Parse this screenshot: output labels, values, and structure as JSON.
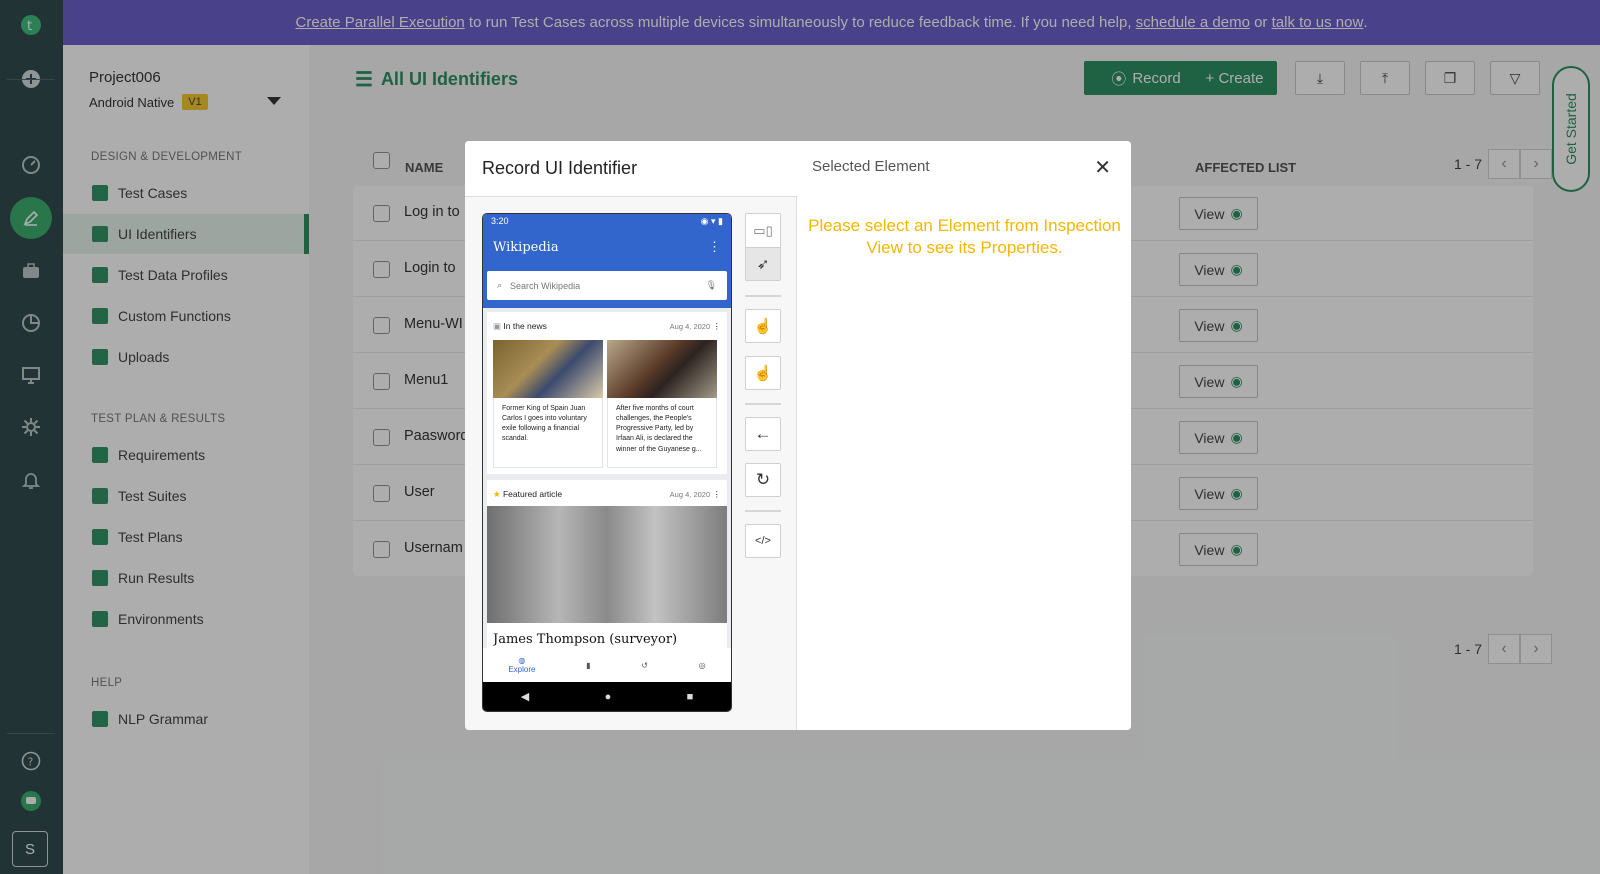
{
  "banner": {
    "link1": "Create Parallel Execution",
    "text1": " to run Test Cases across multiple devices simultaneously to reduce feedback time. If you need help, ",
    "link2": "schedule a demo",
    "text2": " or ",
    "link3": "talk to us now",
    "text3": "."
  },
  "project": {
    "name": "Project006",
    "platform": "Android Native",
    "version": "V1"
  },
  "sidebar": {
    "sections": [
      {
        "title": "DESIGN & DEVELOPMENT",
        "items": [
          "Test Cases",
          "UI Identifiers",
          "Test Data Profiles",
          "Custom Functions",
          "Uploads"
        ]
      },
      {
        "title": "TEST PLAN & RESULTS",
        "items": [
          "Requirements",
          "Test Suites",
          "Test Plans",
          "Run Results",
          "Environments"
        ]
      },
      {
        "title": "HELP",
        "items": [
          "NLP Grammar"
        ]
      }
    ],
    "active": "UI Identifiers"
  },
  "rail": {
    "user_initial": "S"
  },
  "header": {
    "title": "All UI Identifiers",
    "record_label": "Record",
    "create_label": "+ Create"
  },
  "table": {
    "col_name": "NAME",
    "col_affected": "AFFECTED LIST",
    "rows": [
      {
        "name": "Log in to",
        "action": "View"
      },
      {
        "name": "Login to",
        "action": "View"
      },
      {
        "name": "Menu-WI",
        "action": "View"
      },
      {
        "name": "Menu1",
        "action": "View"
      },
      {
        "name": "Paasword",
        "action": "View"
      },
      {
        "name": "User",
        "action": "View"
      },
      {
        "name": "Usernam",
        "action": "View"
      }
    ],
    "pager_text": "1 - 7"
  },
  "get_started": "Get Started",
  "modal": {
    "title": "Record UI Identifier",
    "selected_title": "Selected Element",
    "message": "Please select an Element from Inspection View to see its Properties.",
    "phone": {
      "time": "3:20",
      "app_title": "Wikipedia",
      "search_placeholder": "Search Wikipedia",
      "news_label": "In the news",
      "news_date": "Aug 4, 2020",
      "news1": "Former King of Spain Juan Carlos I goes into voluntary exile following a financial scandal.",
      "news2": "After five months of court challenges, the People's Progressive Party, led by Irfaan Ali, is declared the winner of the Guyanese g...",
      "featured_label": "Featured article",
      "featured_date": "Aug 4, 2020",
      "featured_title": "James Thompson (surveyor)",
      "tab_explore": "Explore"
    }
  },
  "colors": {
    "brand_green": "#198754",
    "banner_purple": "#5e51c6",
    "rail": "#1d3a3c",
    "message_yellow": "#f5b700"
  }
}
